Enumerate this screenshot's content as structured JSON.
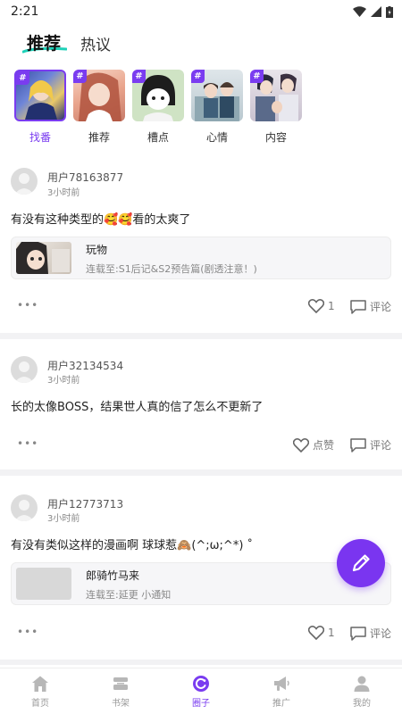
{
  "status_bar": {
    "time": "2:21",
    "icons": [
      "wifi-icon",
      "signal-icon",
      "battery-icon"
    ]
  },
  "header": {
    "tab_active": "推荐",
    "tab_other": "热议"
  },
  "topics": [
    {
      "label": "找番",
      "selected": true
    },
    {
      "label": "推荐",
      "selected": false
    },
    {
      "label": "槽点",
      "selected": false
    },
    {
      "label": "心情",
      "selected": false
    },
    {
      "label": "内容",
      "selected": false
    }
  ],
  "topic_hash": "#",
  "posts": [
    {
      "user": "用户78163877",
      "time": "3小时前",
      "text": "有没有这种类型的🥰🥰看的太爽了",
      "card": {
        "title": "玩物",
        "sub": "连载至:S1后记&S2预告篇(剧透注意！)"
      },
      "likes": "1",
      "comment": "评论",
      "more": "•••"
    },
    {
      "user": "用户32134534",
      "time": "3小时前",
      "text": "长的太像BOSS，结果世人真的信了怎么不更新了",
      "likes": "点赞",
      "comment": "评论",
      "more": "•••"
    },
    {
      "user": "用户12773713",
      "time": "3小时前",
      "text": "有没有类似这样的漫画啊 球球惹🙈(^;ω;^*) ˚",
      "card": {
        "title": "郎骑竹马来",
        "sub": "连载至:延更 小通知"
      },
      "likes": "1",
      "comment": "评论",
      "more": "•••"
    }
  ],
  "bottom_nav": [
    {
      "label": "首页",
      "icon": "home-icon",
      "active": false
    },
    {
      "label": "书架",
      "icon": "bookshelf-icon",
      "active": false
    },
    {
      "label": "圈子",
      "icon": "circle-icon",
      "active": true
    },
    {
      "label": "推广",
      "icon": "megaphone-icon",
      "active": false
    },
    {
      "label": "我的",
      "icon": "profile-icon",
      "active": false
    }
  ],
  "colors": {
    "accent": "#7a3cf0",
    "fab": "#7a35f0",
    "teal_underline": "#1ed1b8",
    "divider": "#f2f2f4"
  }
}
